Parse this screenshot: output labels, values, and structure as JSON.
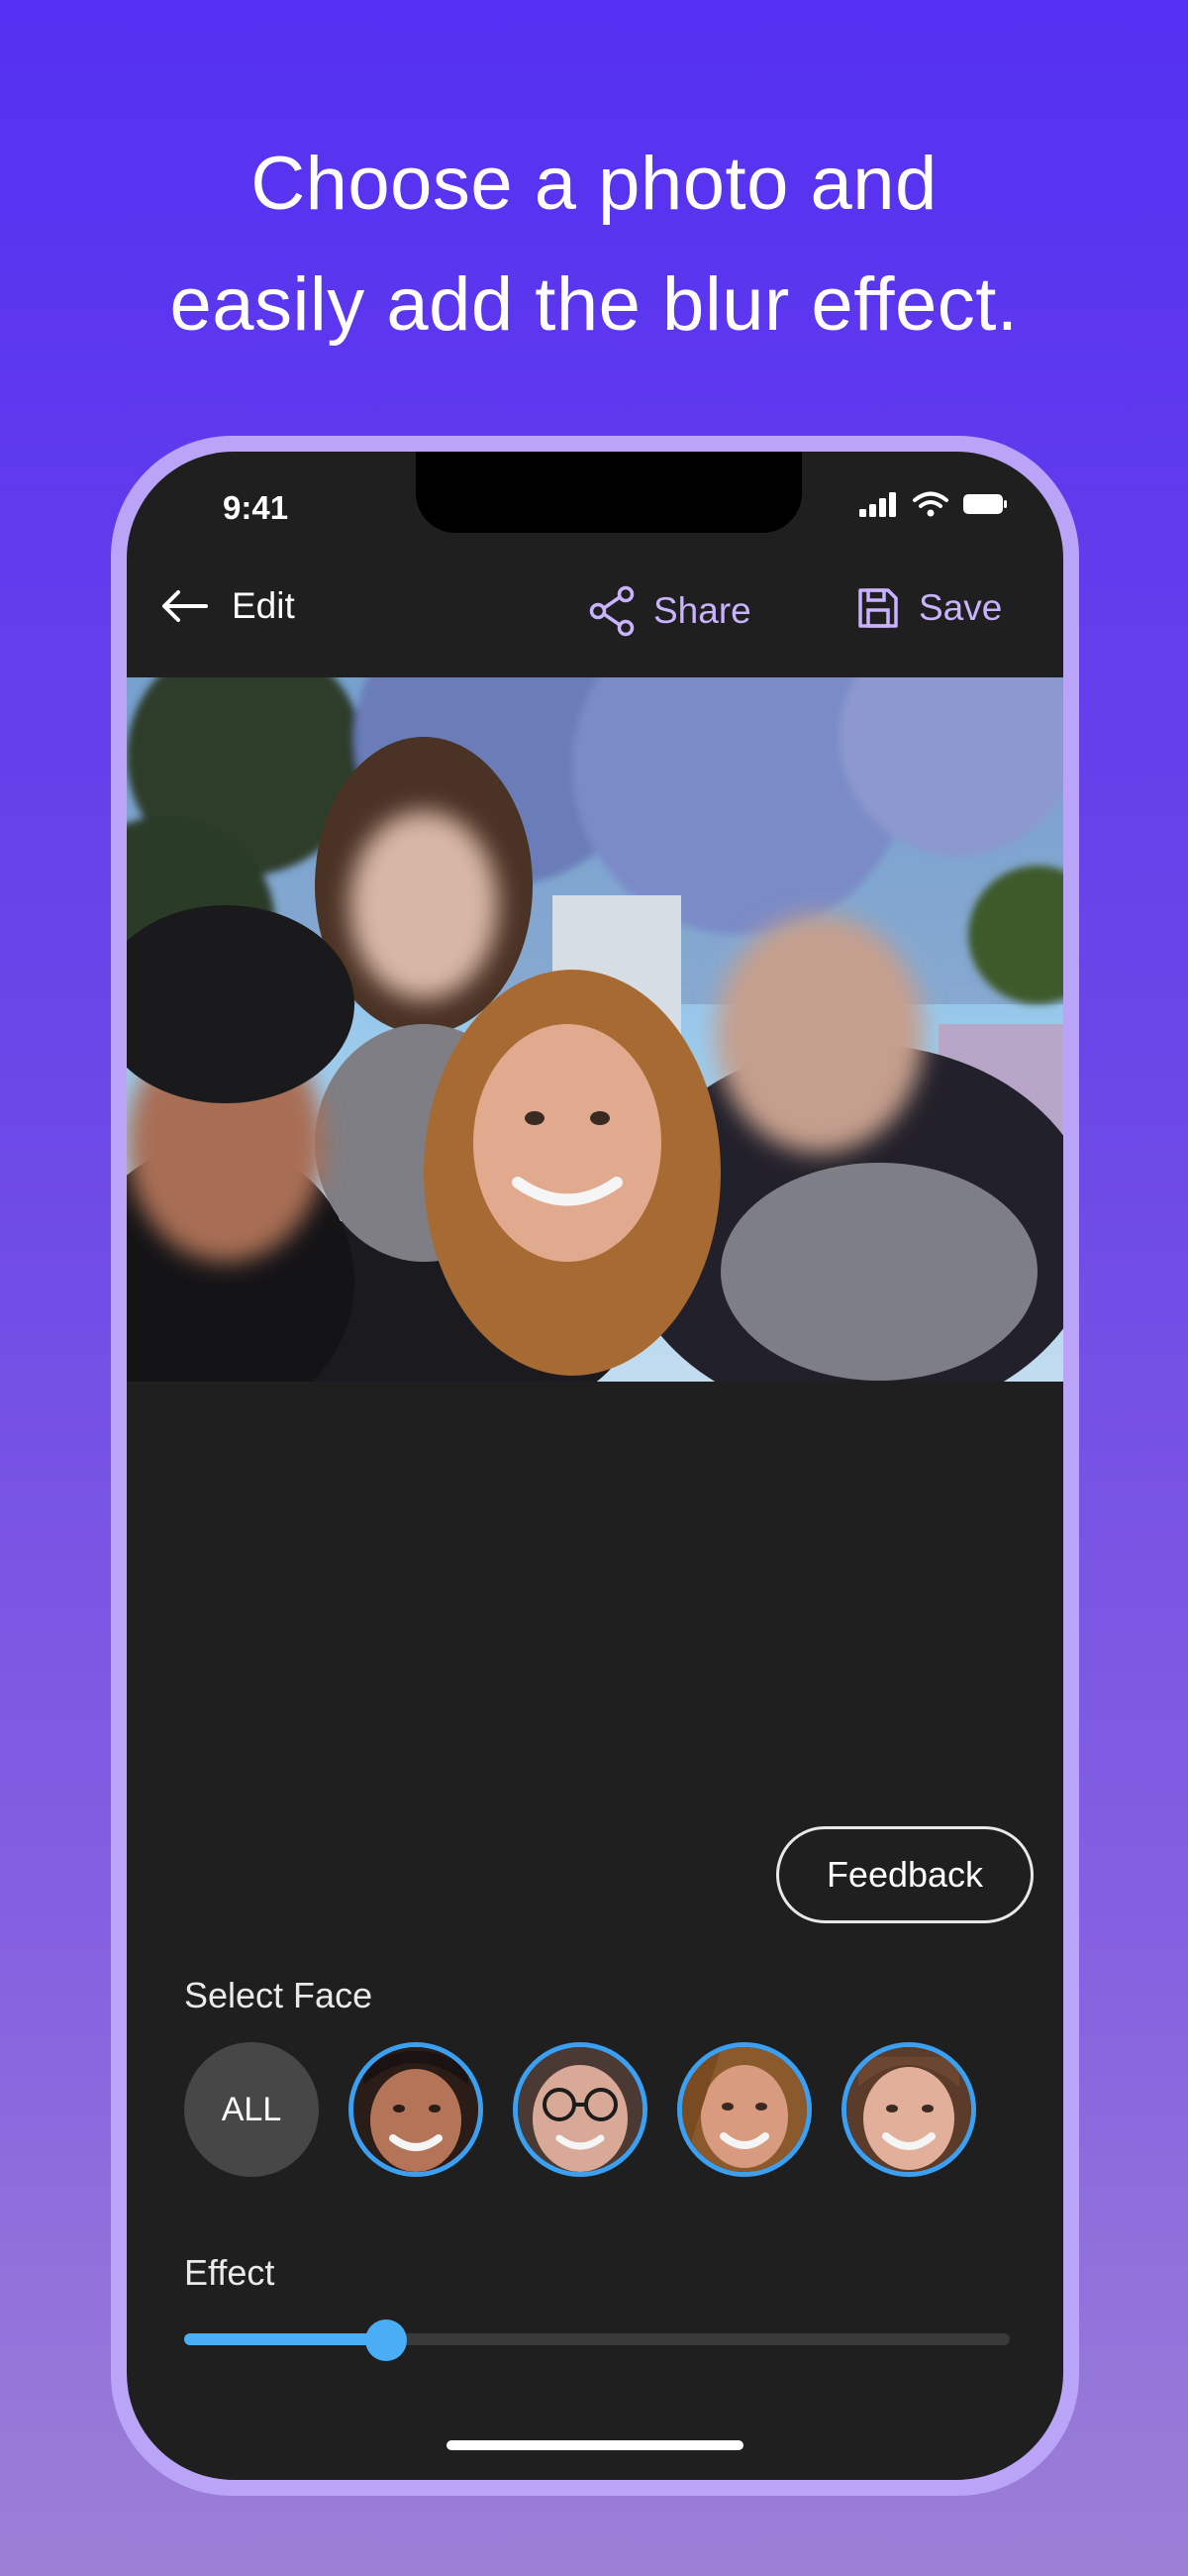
{
  "headline": {
    "line1": "Choose a photo and",
    "line2": "easily add the blur effect."
  },
  "status_bar": {
    "time": "9:41",
    "icons": [
      "signal-icon",
      "wifi-icon",
      "battery-icon"
    ]
  },
  "toolbar": {
    "back_label": "Edit",
    "share_label": "Share",
    "save_label": "Save",
    "accent_color": "#c9b2ff"
  },
  "feedback_label": "Feedback",
  "faces": {
    "label": "Select Face",
    "all_label": "ALL",
    "items": [
      "face-1",
      "face-2",
      "face-3",
      "face-4"
    ],
    "ring_color": "#3ba0f2"
  },
  "effect": {
    "label": "Effect",
    "value": 0.245
  }
}
